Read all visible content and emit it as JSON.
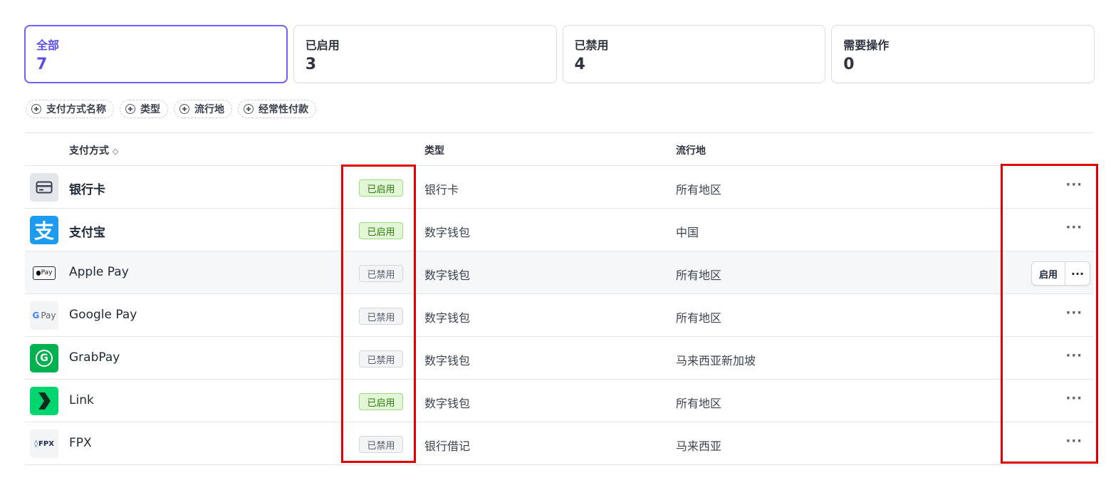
{
  "summary": [
    {
      "label": "全部",
      "count": "7"
    },
    {
      "label": "已启用",
      "count": "3"
    },
    {
      "label": "已禁用",
      "count": "4"
    },
    {
      "label": "需要操作",
      "count": "0"
    }
  ],
  "filters": [
    "支付方式名称",
    "类型",
    "流行地",
    "经常性付款"
  ],
  "columns": {
    "method": "支付方式",
    "sort_icon": "◇",
    "type": "类型",
    "region": "流行地"
  },
  "rows": [
    {
      "name": "银行卡",
      "status": "已启用",
      "type": "银行卡",
      "region": "所有地区",
      "icon": "card-icon"
    },
    {
      "name": "支付宝",
      "status": "已启用",
      "type": "数字钱包",
      "region": "中国",
      "icon": "alipay-logo",
      "logo_text": "支"
    },
    {
      "name": "Apple Pay",
      "status": "已禁用",
      "type": "数字钱包",
      "region": "所有地区",
      "icon": "apple-pay-logo",
      "logo_text": "Pay"
    },
    {
      "name": "Google Pay",
      "status": "已禁用",
      "type": "数字钱包",
      "region": "所有地区",
      "icon": "google-pay-logo",
      "logo_text": "Pay"
    },
    {
      "name": "GrabPay",
      "status": "已禁用",
      "type": "数字钱包",
      "region": "马来西亚新加坡",
      "icon": "grabpay-logo",
      "logo_text": "G"
    },
    {
      "name": "Link",
      "status": "已启用",
      "type": "数字钱包",
      "region": "所有地区",
      "icon": "link-logo"
    },
    {
      "name": "FPX",
      "status": "已禁用",
      "type": "银行借记",
      "region": "马来西亚",
      "icon": "fpx-logo",
      "logo_text": "FPX"
    }
  ],
  "row_actions": {
    "enable_label": "启用",
    "more_label": "···"
  },
  "colors": {
    "accent": "#5b4ee8",
    "enabled_bg": "#e3f7d8",
    "enabled_text": "#2b7a0b",
    "highlight": "#e00000"
  }
}
